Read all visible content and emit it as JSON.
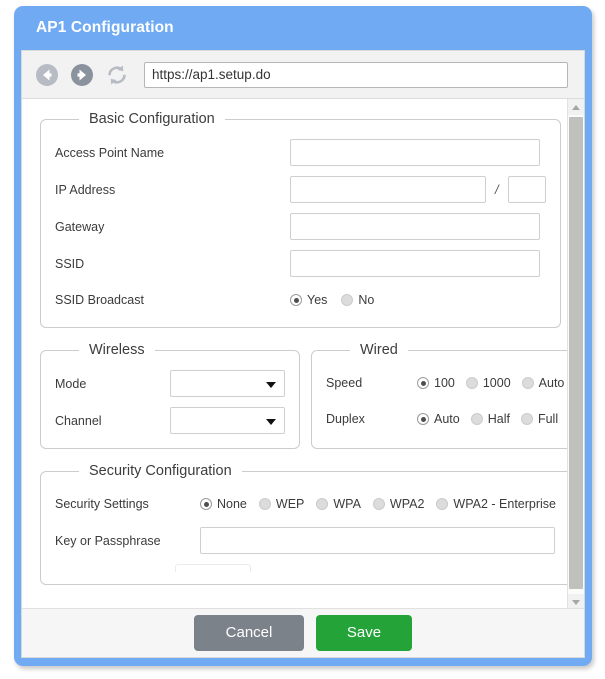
{
  "window": {
    "title": "AP1 Configuration",
    "frame_color": "#6faaf2"
  },
  "nav": {
    "back_icon": "circle-arrow-left-icon",
    "forward_icon": "circle-arrow-right-icon",
    "reload_icon": "refresh-icon",
    "url_value": "https://ap1.setup.do",
    "url_placeholder": "Enter address"
  },
  "basic": {
    "legend": "Basic Configuration",
    "access_point_name": {
      "label": "Access Point Name",
      "value": "",
      "placeholder": ""
    },
    "ip_address": {
      "label": "IP Address",
      "value": "",
      "placeholder": "",
      "separator": "/",
      "prefix_value": "",
      "prefix_placeholder": ""
    },
    "gateway": {
      "label": "Gateway",
      "value": "",
      "placeholder": ""
    },
    "ssid": {
      "label": "SSID",
      "value": "",
      "placeholder": ""
    },
    "ssid_broadcast": {
      "label": "SSID Broadcast",
      "options": [
        {
          "label": "Yes",
          "selected": true
        },
        {
          "label": "No",
          "selected": false
        }
      ]
    }
  },
  "wireless": {
    "legend": "Wireless",
    "mode": {
      "label": "Mode",
      "value": "",
      "caret": "chevron-down-icon"
    },
    "channel": {
      "label": "Channel",
      "value": "",
      "caret": "chevron-down-icon"
    }
  },
  "wired": {
    "legend": "Wired",
    "speed": {
      "label": "Speed",
      "options": [
        {
          "label": "100",
          "selected": true
        },
        {
          "label": "1000",
          "selected": false
        },
        {
          "label": "Auto",
          "selected": false
        }
      ]
    },
    "duplex": {
      "label": "Duplex",
      "options": [
        {
          "label": "Auto",
          "selected": true
        },
        {
          "label": "Half",
          "selected": false
        },
        {
          "label": "Full",
          "selected": false
        }
      ]
    }
  },
  "security": {
    "legend": "Security Configuration",
    "settings": {
      "label": "Security Settings",
      "options": [
        {
          "label": "None",
          "selected": true
        },
        {
          "label": "WEP",
          "selected": false
        },
        {
          "label": "WPA",
          "selected": false
        },
        {
          "label": "WPA2",
          "selected": false
        },
        {
          "label": "WPA2 - Enterprise",
          "selected": false
        }
      ]
    },
    "key": {
      "label": "Key or Passphrase",
      "value": "",
      "placeholder": ""
    }
  },
  "footer": {
    "cancel_label": "Cancel",
    "save_label": "Save",
    "cancel_color": "#7c8289",
    "save_color": "#24a338"
  },
  "scrollbar": {
    "up_icon": "caret-up-icon",
    "down_icon": "caret-down-icon"
  }
}
